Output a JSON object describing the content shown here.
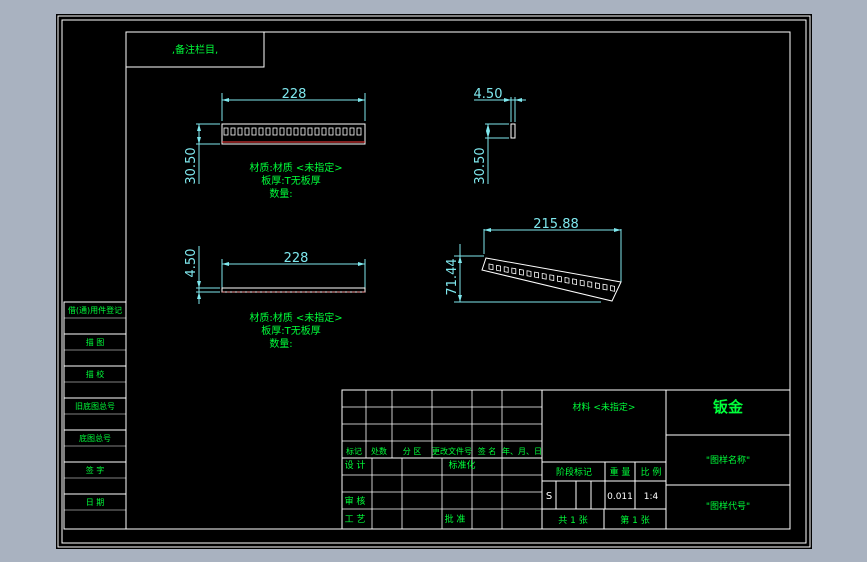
{
  "stamp": ",备注栏目,",
  "views": {
    "front": {
      "width": "228",
      "height": "30.50"
    },
    "side": {
      "thickness": "4.50",
      "height": "30.50"
    },
    "top": {
      "width": "228",
      "thickness": "4.50"
    },
    "iso": {
      "width": "215.88",
      "height": "71.44"
    }
  },
  "notes": {
    "front": {
      "material": "材质:材质 <未指定>",
      "thickness": "板厚:T无板厚",
      "quantity": "数量:"
    },
    "top": {
      "material": "材质:材质 <未指定>",
      "thickness": "板厚:T无板厚",
      "quantity": "数量:"
    }
  },
  "side_panel": [
    "借(通)用件登记",
    "描 图",
    "描 校",
    "旧底图总号",
    "底图总号",
    "签 字",
    "日 期"
  ],
  "title_block": {
    "material": "材料 <未指定>",
    "name": "钣金",
    "drawing_name": "\"图样名称\"",
    "drawing_code": "\"图样代号\"",
    "headers": [
      "标记",
      "处数",
      "分 区",
      "更改文件号",
      "签 名",
      "年、月、日"
    ],
    "design": "设 计",
    "standardize": "标准化",
    "review": "审 核",
    "process": "工 艺",
    "approve": "批 准",
    "stage_label": "阶段标记",
    "weight_label": "重 量",
    "scale_label": "比 例",
    "stage": "S",
    "weight": "0.011",
    "scale": "1:4",
    "sheets_total": "共 1 张",
    "sheet_no": "第 1 张"
  }
}
